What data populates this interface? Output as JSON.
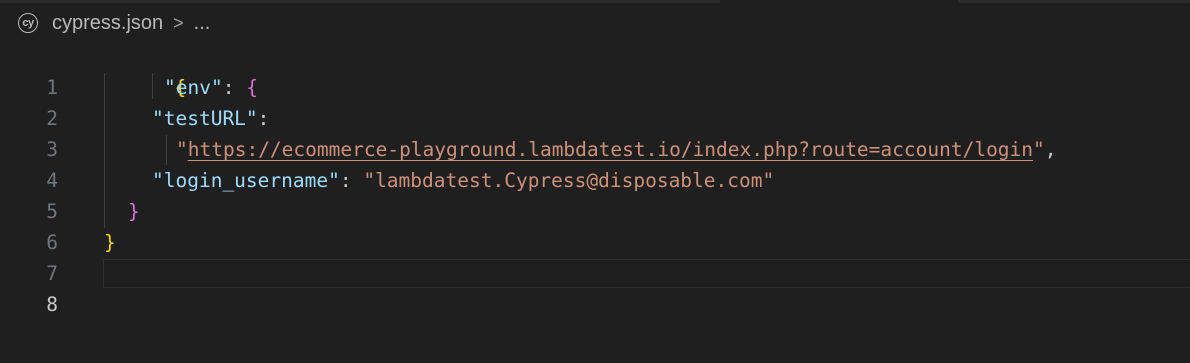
{
  "breadcrumb": {
    "icon": "cypress-icon",
    "icon_text": "cy",
    "file": "cypress.json",
    "separator": ">",
    "ellipsis": "..."
  },
  "editor": {
    "active_line": 8,
    "lines": [
      {
        "number": "1"
      },
      {
        "number": "2"
      },
      {
        "number": "3"
      },
      {
        "number": "4"
      },
      {
        "number": "5"
      },
      {
        "number": "6"
      },
      {
        "number": "7"
      },
      {
        "number": "8"
      }
    ],
    "tokens": {
      "open_brace": "{",
      "env_key": "\"env\"",
      "colon_space": ": ",
      "env_open": "{",
      "testurl_key": "\"testURL\"",
      "colon": ":",
      "url_quote_open": "\"",
      "url_value": "https://ecommerce-playground.lambdatest.io/index.php?route=account/login",
      "url_quote_close": "\"",
      "comma": ",",
      "username_key": "\"login_username\"",
      "username_value": "\"lambdatest.Cypress@disposable.com\"",
      "env_close": "}",
      "close_brace": "}"
    },
    "colors": {
      "background": "#1f1f1f",
      "key": "#9cdcfe",
      "string": "#ce9178",
      "brace_level1": "#ffd700",
      "brace_level2": "#da70d6",
      "line_number": "#6e7681",
      "active_line_number": "#cccccc"
    }
  }
}
